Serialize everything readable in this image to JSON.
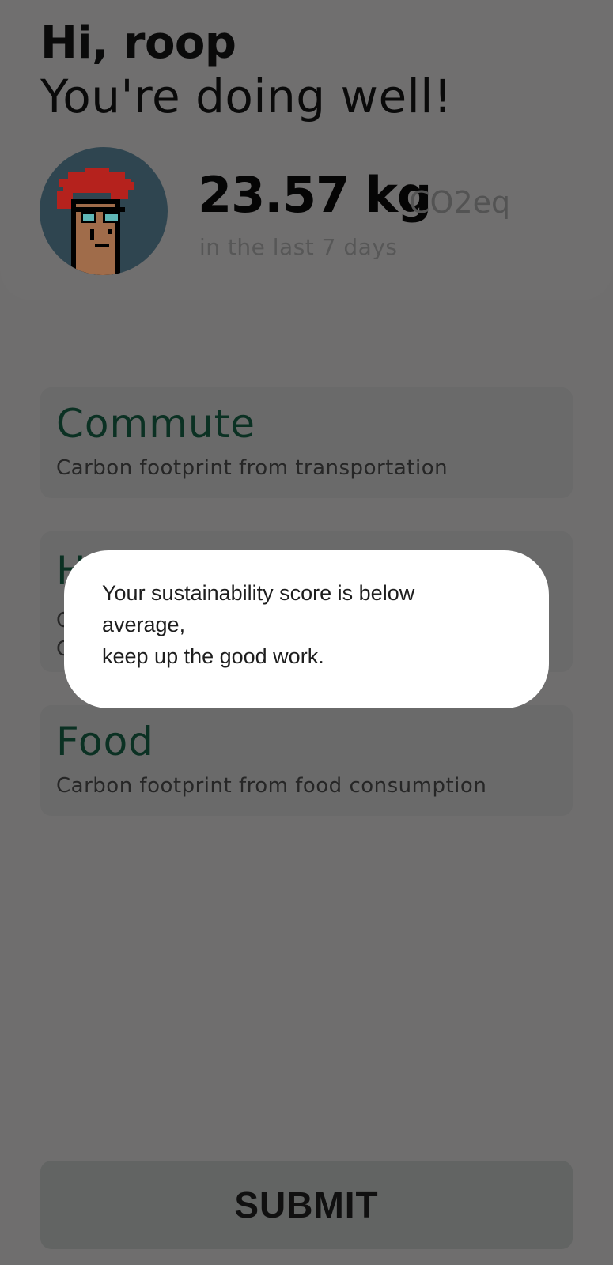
{
  "header": {
    "greeting": "Hi, roop",
    "subgreeting": "You're doing well!",
    "avatar_icon": "pixel-avatar-icon",
    "amount": "23.57 kg",
    "unit": "CO2eq",
    "period": "in the last 7 days"
  },
  "categories": [
    {
      "title": "Commute",
      "description": "Carbon footprint from transportation"
    },
    {
      "title": "H",
      "description_lines": [
        "C",
        "C"
      ]
    },
    {
      "title": "Food",
      "description": "Carbon footprint from food consumption"
    }
  ],
  "submit": {
    "label": "SUBMIT"
  },
  "dialog": {
    "lines": [
      "Your sustainability score is below",
      "average,",
      "keep up the good work."
    ]
  },
  "colors": {
    "overlay_background": "#6f6e6e",
    "card_title": "#0b3123",
    "dialog_background": "#ffffff"
  }
}
